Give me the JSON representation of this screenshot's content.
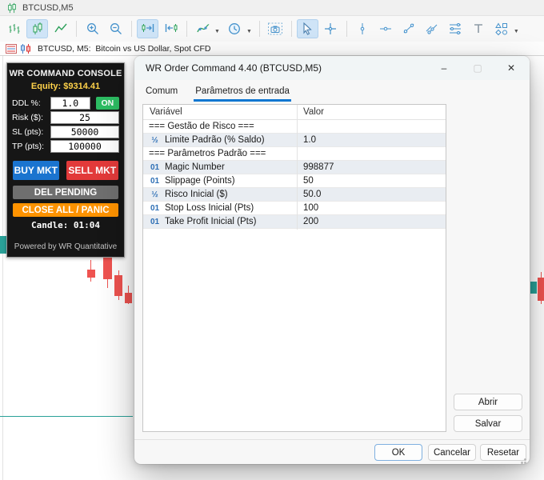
{
  "titlebar": {
    "symbol": "BTCUSD,M5"
  },
  "toolbar": {
    "items": [
      "bars-chart",
      "candlestick-chart",
      "line-chart",
      "zoom-in",
      "zoom-out",
      "shift-chart-to-end",
      "shift-chart-left",
      "indicators",
      "timeframes",
      "screenshot",
      "cursor",
      "crosshair",
      "vertical-line",
      "horizontal-line",
      "trendline",
      "equidistant-channel",
      "fibonacci-lines",
      "text-tool",
      "shapes"
    ],
    "selected": [
      "candlestick-chart",
      "shift-chart-to-end",
      "cursor"
    ]
  },
  "chart_header": {
    "label": "BTCUSD, M5:  Bitcoin vs US Dollar, Spot CFD"
  },
  "console": {
    "title": "WR COMMAND CONSOLE",
    "equity": "Equity: $9314.41",
    "fields": [
      {
        "label": "DDL %:",
        "value": "1.0"
      },
      {
        "label": "Risk ($):",
        "value": "25"
      },
      {
        "label": "SL (pts):",
        "value": "50000"
      },
      {
        "label": "TP (pts):",
        "value": "100000"
      }
    ],
    "on_toggle": "ON",
    "buy_button": "BUY MKT",
    "sell_button": "SELL MKT",
    "del_pending_button": "DEL PENDING",
    "close_all_button": "CLOSE ALL / PANIC",
    "candle_timer": "Candle: 01:04",
    "footer": "Powered by WR Quantitative"
  },
  "dialog": {
    "title": "WR Order Command 4.40 (BTCUSD,M5)",
    "window_icons": {
      "minimize": "–",
      "maximize": "▢",
      "close": "✕"
    },
    "tabs": {
      "common": "Comum",
      "inputs": "Parâmetros de entrada"
    },
    "table": {
      "col_variable": "Variável",
      "col_value": "Valor",
      "rows": [
        {
          "icon": "",
          "name": "=== Gestão de Risco ===",
          "value": ""
        },
        {
          "icon": "½",
          "name": "Limite Padrão (% Saldo)",
          "value": "1.0"
        },
        {
          "icon": "",
          "name": "=== Parâmetros Padrão ===",
          "value": ""
        },
        {
          "icon": "01",
          "name": "Magic Number",
          "value": "998877"
        },
        {
          "icon": "01",
          "name": "Slippage (Points)",
          "value": "50"
        },
        {
          "icon": "½",
          "name": "Risco Inicial ($)",
          "value": "50.0"
        },
        {
          "icon": "01",
          "name": "Stop Loss Inicial (Pts)",
          "value": "100"
        },
        {
          "icon": "01",
          "name": "Take Profit Inicial (Pts)",
          "value": "200"
        }
      ]
    },
    "buttons": {
      "open": "Abrir",
      "save": "Salvar",
      "ok": "OK",
      "cancel": "Cancelar",
      "reset": "Resetar"
    }
  },
  "colors": {
    "buy_blue": "#1b74cf",
    "sell_red": "#e23a3a",
    "panic_orange": "#ff9300",
    "on_green": "#2dbd63",
    "equity_gold": "#ffd24a",
    "bull_teal": "#2aa198",
    "bear_red": "#ef5350",
    "accent_blue": "#1177d1"
  }
}
